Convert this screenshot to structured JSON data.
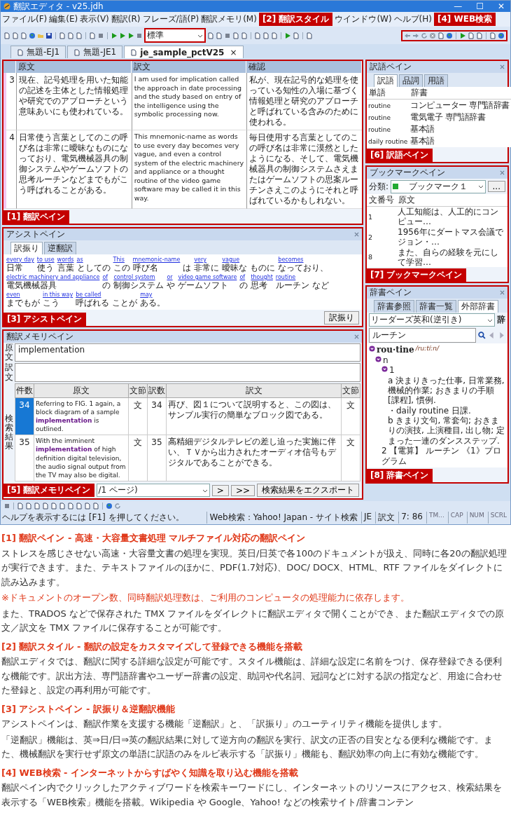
{
  "window": {
    "title": "翻訳エディタ - v25.jdh",
    "controls": [
      "—",
      "☐",
      "✕"
    ]
  },
  "menu_left": [
    "ファイル(F)",
    "編集(E)",
    "表示(V)",
    "翻訳(R)",
    "フレーズ/語(P)",
    "翻訳メモリ(M)"
  ],
  "menu_right": [
    "ウインドウ(W)",
    "ヘルプ(H)"
  ],
  "callouts": [
    "[1] 翻訳ペイン",
    "[2] 翻訳スタイル",
    "[3] アシストペイン",
    "[4] WEB検索",
    "[5] 翻訳メモリペイン",
    "[6] 訳語ペイン",
    "[7] ブックマークペイン",
    "[8] 辞書ペイン"
  ],
  "style_combo": {
    "value": "標準"
  },
  "doc_tabs": [
    {
      "label": "無題-EJ1",
      "selected": false
    },
    {
      "label": "無題-JE1",
      "selected": false
    },
    {
      "label": "je_sample_pctV25",
      "selected": true,
      "close": "×"
    }
  ],
  "translation_pane": {
    "columns": [
      "原文",
      "訳文",
      "確認"
    ],
    "rows": [
      {
        "number": "3",
        "source": "現在、記号処理を用いた知能の記述を主体とした情報処理や研究でのアプローチという意味あいにも使われている。",
        "target": "I am used for implication called the approach in date processing and the study based on entry of the intelligence using the symbolic processing now.",
        "check": "私が、現在記号的な処理を使っている知性の入場に基づく情報処理と研究のアプローチと呼ばれている含みのために使われる。"
      },
      {
        "number": "4",
        "source": "日常使う言葉としてのこの呼び名は非常に曖昧なものになっており、電気機械器具の制御システムやゲームソフトの思考ルーチンなどまでもがこう呼ばれることがある。",
        "target": "This mnemonic-name as words to use every day becomes very vague, and even a control system of the electric machinery and appliance or a thought routine of the video game software may be called it in this way.",
        "check": "毎日使用する言葉としてのこの呼び名は非常に漠然としたようになる、そして、電気機械器具の制御システムさえまたはゲームソフトの思案ルーチンさえこのようにそれと呼ばれているかもしれない。"
      }
    ]
  },
  "assist_pane": {
    "title": "アシストペイン",
    "tabs": [
      {
        "label": "訳振り",
        "selected": true
      },
      {
        "label": "逆翻訳",
        "selected": false
      }
    ],
    "segments": [
      {
        "gloss": "every day",
        "text": "日常"
      },
      {
        "gloss": "to use",
        "text": "使う"
      },
      {
        "gloss": "words",
        "text": "言葉"
      },
      {
        "gloss": "as",
        "text": "としての"
      },
      {
        "gloss": "This",
        "text": "この"
      },
      {
        "gloss": "mnemonic-name",
        "text": "呼び名"
      },
      {
        "text": "は"
      },
      {
        "gloss": "very",
        "text": "非常に"
      },
      {
        "gloss": "vague",
        "text": "曖昧な"
      },
      {
        "text": "ものに"
      },
      {
        "gloss": "becomes",
        "text": "なっており、"
      },
      {
        "gloss": "electric machinery and appliance",
        "text": "電気機械器具"
      },
      {
        "gloss": "of",
        "text": "の"
      },
      {
        "gloss": "control system",
        "text": "制御システム"
      },
      {
        "gloss": "or",
        "text": "や"
      },
      {
        "gloss": "video game software",
        "text": "ゲームソフト"
      },
      {
        "gloss": "of",
        "text": "の"
      },
      {
        "gloss": "thought",
        "text": "思考"
      },
      {
        "gloss": "routine",
        "text": "ルーチン"
      },
      {
        "text": "など"
      },
      {
        "gloss": "even",
        "text": "までもが"
      },
      {
        "gloss": "in this way",
        "text": "こう"
      },
      {
        "gloss": "be called",
        "text": "呼ばれる"
      },
      {
        "text": "ことが"
      },
      {
        "gloss": "may",
        "text": "ある。"
      }
    ],
    "button": "訳振り"
  },
  "memory_pane": {
    "title": "翻訳メモリペイン",
    "source_label": "原文",
    "source_value": "implementation",
    "target_label": "訳文",
    "results_label": "検索結果",
    "columns": [
      "件数",
      "原文",
      "文節",
      "訳数",
      "訳文",
      "文節"
    ],
    "rows": [
      {
        "cells": [
          "34",
          "Referring to FIG. 1 again, a block diagram of a sample **implementation** is outlined.",
          "文",
          "34",
          "再び、図１について説明すると、この図は、サンプル実行の簡単なブロック図である。",
          "文"
        ],
        "selected": true
      },
      {
        "cells": [
          "35",
          "With the imminent **implementation** of high definition digital television, the audio signal output from the TV may also be digital.",
          "文",
          "35",
          "高精細デジタルテレビの差し迫った実施に伴い、ＴＶから出力されたオーディオ信号もデジタルであることができる。",
          "文"
        ],
        "selected": false
      }
    ],
    "page_combo": "/1 ページ)",
    "next": ">",
    "last": ">>",
    "export": "検索結果をエクスポート"
  },
  "terms_pane": {
    "title": "訳語ペイン",
    "tabs": [
      {
        "label": "訳語",
        "selected": true
      },
      {
        "label": "品詞",
        "selected": false
      },
      {
        "label": "用語",
        "selected": false
      }
    ],
    "columns": [
      "単語",
      "辞書"
    ],
    "rows": [
      [
        "routine",
        "コンピューター 専門語辞書"
      ],
      [
        "routine",
        "電気電子 専門語辞書"
      ],
      [
        "routine",
        "基本語"
      ],
      [
        "daily routine",
        "基本語"
      ]
    ]
  },
  "bookmark_pane": {
    "title": "ブックマークペイン",
    "category_label": "分類:",
    "category": "ブックマーク１",
    "more": "...",
    "columns": [
      "文番号",
      "原文"
    ],
    "rows": [
      [
        "1",
        "人工知能は、人工的にコンピュー…"
      ],
      [
        "2",
        "1956年にダートマス会議でジョン・…"
      ],
      [
        "8",
        "また、自らの経験を元にして学習…"
      ]
    ]
  },
  "dictionary_pane": {
    "title": "辞書ペイン",
    "tabs": [
      {
        "label": "辞書参照",
        "selected": false
      },
      {
        "label": "辞書一覧",
        "selected": false
      },
      {
        "label": "外部辞書",
        "selected": true
      }
    ],
    "dictionary": "リーダーズ英和(逆引き)",
    "dict_mark": "辞",
    "query": "ルーチン",
    "entry": {
      "text": "rou·tine",
      "pronunciation": "/ruːtíːn/",
      "children": [
        {
          "text": "n",
          "children": [
            {
              "text": "1",
              "children": [
                {
                  "text": "a 決まりきった仕事, 日常業務, 機械的作業; おきまりの手順 [課程], 慣例."
                },
                {
                  "text": "・daily routine 日課."
                },
                {
                  "text": "b きまり文句, 常套句; おきまりの演技, 上演種目, 出し物; 定まった一連のダンスステップ."
                }
              ]
            },
            {
              "text": "2 【電算】 ルーチン 《1》プログラム"
            }
          ]
        }
      ]
    }
  },
  "status_bar": {
    "help": "ヘルプを表示するには [F1] を押してください。",
    "web": "Web検索：Yahoo! Japan - サイト検索",
    "mode": "JE",
    "field": "訳文",
    "position": "7: 86",
    "indicators": [
      "TM...",
      "CAP",
      "NUM",
      "SCRL"
    ]
  },
  "article": [
    {
      "kind": "heading",
      "text": "[1] 翻訳ペイン - 高速・大容量文書処理 マルチファイル対応の翻訳ペイン"
    },
    {
      "kind": "paragraph",
      "text": "ストレスを感じさせない高速・大容量文書の処理を実現。英日/日英で各100のドキュメントが扱え、同時に各20の翻訳処理が実行できます。また、テキストファイルのほかに、PDF(1.7対応)、DOC/ DOCX、HTML、RTF ファイルをダイレクトに読み込みます。"
    },
    {
      "kind": "note",
      "text": "※ドキュメントのオープン数、同時翻訳処理数は、ご利用のコンピュータの処理能力に依存します。"
    },
    {
      "kind": "paragraph",
      "text": "また、TRADOS などで保存された TMX ファイルをダイレクトに翻訳エディタで開くことができ、また翻訳エディタでの原文／訳文を TMX ファイルに保存することが可能です。"
    },
    {
      "kind": "heading",
      "text": "[2] 翻訳スタイル - 翻訳の設定をカスタマイズして登録できる機能を搭載"
    },
    {
      "kind": "paragraph",
      "text": "翻訳エディタでは、翻訳に関する詳細な設定が可能です。スタイル機能は、詳細な設定に名前をつけ、保存登録できる便利な機能です。訳出方法、専門語辞書やユーザー辞書の設定、助詞や代名詞、冠詞などに対する訳の指定など、用途に合わせた登録と、設定の再利用が可能です。"
    },
    {
      "kind": "heading",
      "text": "[3] アシストペイン - 訳振り＆逆翻訳機能"
    },
    {
      "kind": "paragraph",
      "text": "アシストペインは、翻訳作業を支援する機能「逆翻訳」と、「訳振り」のユーティリティ機能を提供します。"
    },
    {
      "kind": "paragraph",
      "text": "「逆翻訳」機能は、英⇒日/日⇒英の翻訳結果に対して逆方向の翻訳を実行、訳文の正否の目安となる便利な機能です。また、機械翻訳を実行せず原文の単語に訳語のみをルビ表示する「訳振り」機能も、翻訳効率の向上に有効な機能です。"
    },
    {
      "kind": "heading",
      "text": "[4] WEB検索 - インターネットからすばやく知識を取り込む機能を搭載"
    },
    {
      "kind": "paragraph",
      "text": "翻訳ペイン内でクリックしたアクティブワードを検索キーワードにし、インターネットのリソースにアクセス、検索結果を表示する「WEB検索」機能を搭載。Wikipedia や Google、Yahoo! などの検索サイト/辞書コンテン"
    }
  ]
}
